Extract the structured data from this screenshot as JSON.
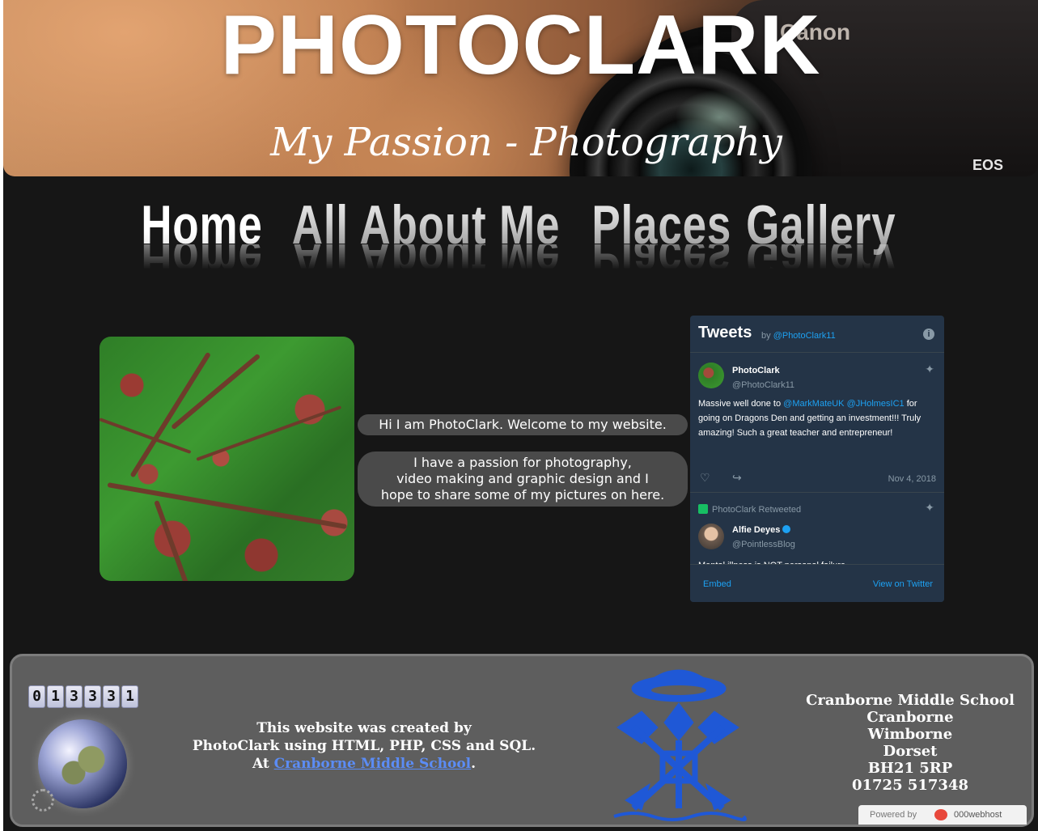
{
  "header": {
    "title": "PHOTOCLARK",
    "tagline": "My Passion - Photography",
    "camera_brand": "Canon",
    "camera_model": "EOS"
  },
  "nav": {
    "items": [
      {
        "label": "Home",
        "active": true
      },
      {
        "label": "All About Me",
        "active": false
      },
      {
        "label": "Places",
        "active": false
      },
      {
        "label": "Gallery",
        "active": false
      }
    ]
  },
  "main": {
    "welcome": "Hi I am PhotoClark. Welcome to my website.",
    "intro_lines": [
      "I have a passion for photography,",
      "video making and graphic design and I",
      "hope to share some of my pictures on here."
    ]
  },
  "twitter": {
    "title": "Tweets",
    "by": "by",
    "handle_link": "@PhotoClark11",
    "info_icon": "info-icon",
    "tweet1": {
      "name": "PhotoClark",
      "handle": "@PhotoClark11",
      "text_before": "Massive well done to ",
      "mention1": "@MarkMateUK",
      "mention2": "@JHolmesIC1",
      "text_after": " for going on Dragons Den and getting an investment!!! Truly amazing! Such a great teacher and entrepreneur!",
      "date": "Nov 4, 2018"
    },
    "retweet_label": "PhotoClark Retweeted",
    "tweet2": {
      "name": "Alfie Deyes",
      "handle": "@PointlessBlog",
      "text": "Mental illness is NOT personal failure."
    },
    "embed": "Embed",
    "view_on": "View on Twitter"
  },
  "footer": {
    "counter_digits": [
      "0",
      "1",
      "3",
      "3",
      "3",
      "1"
    ],
    "created_lines": [
      "This website was created by",
      "PhotoClark using HTML, PHP, CSS and SQL."
    ],
    "at_prefix": "At ",
    "school_link": "Cranborne Middle School",
    "at_suffix": ".",
    "address_lines": [
      "Cranborne Middle School",
      "Cranborne",
      "Wimborne",
      "Dorset",
      "BH21 5RP",
      "01725 517348"
    ],
    "powered_by": "Powered by",
    "host_brand": "000webhost"
  },
  "colors": {
    "page_bg": "#161616",
    "footer_bg": "#5e5e5e",
    "twitter_bg": "#243447",
    "link_blue": "#5b8cf5",
    "crest_blue": "#1f58d6"
  }
}
